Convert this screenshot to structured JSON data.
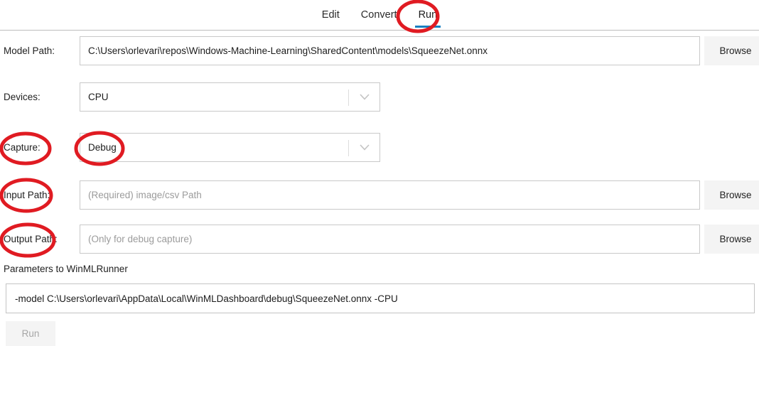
{
  "tabs": [
    {
      "label": "Edit",
      "active": false
    },
    {
      "label": "Convert",
      "active": false
    },
    {
      "label": "Run",
      "active": true
    }
  ],
  "colors": {
    "accent_blue": "#1a7fc1",
    "annotation_red": "#e01b22",
    "field_border": "#c9c9c9",
    "button_bg": "#f4f4f4",
    "disabled_text": "#a6a6a6",
    "placeholder_text": "#9b9b9b",
    "page_bg": "#ffffff"
  },
  "form": {
    "model_path": {
      "label": "Model Path:",
      "value": "C:\\Users\\orlevari\\repos\\Windows-Machine-Learning\\SharedContent\\models\\SqueezeNet.onnx",
      "placeholder": "",
      "browse_label": "Browse"
    },
    "devices": {
      "label": "Devices:",
      "value": "CPU",
      "options": [
        "CPU"
      ],
      "chevron_icon": "chevron-down-icon"
    },
    "capture": {
      "label": "Capture:",
      "value": "Debug",
      "options": [
        "Debug"
      ],
      "chevron_icon": "chevron-down-icon"
    },
    "input_path": {
      "label": "Input Path:",
      "value": "",
      "placeholder": "(Required) image/csv Path",
      "browse_label": "Browse"
    },
    "output_path": {
      "label": "Output Path:",
      "value": "",
      "placeholder": "(Only for debug capture)",
      "browse_label": "Browse"
    }
  },
  "parameters": {
    "label": "Parameters to WinMLRunner",
    "value": "-model C:\\Users\\orlevari\\AppData\\Local\\WinMLDashboard\\debug\\SqueezeNet.onnx -CPU"
  },
  "run_button": {
    "label": "Run",
    "enabled": false
  },
  "annotations": [
    {
      "name": "annotation-circle-run-tab",
      "target": "Run"
    },
    {
      "name": "annotation-circle-capture-label",
      "target": "Capture:"
    },
    {
      "name": "annotation-circle-capture-value",
      "target": "Debug"
    },
    {
      "name": "annotation-circle-input-path-label",
      "target": "Input Path:"
    },
    {
      "name": "annotation-circle-output-path-label",
      "target": "Output Path:"
    }
  ]
}
